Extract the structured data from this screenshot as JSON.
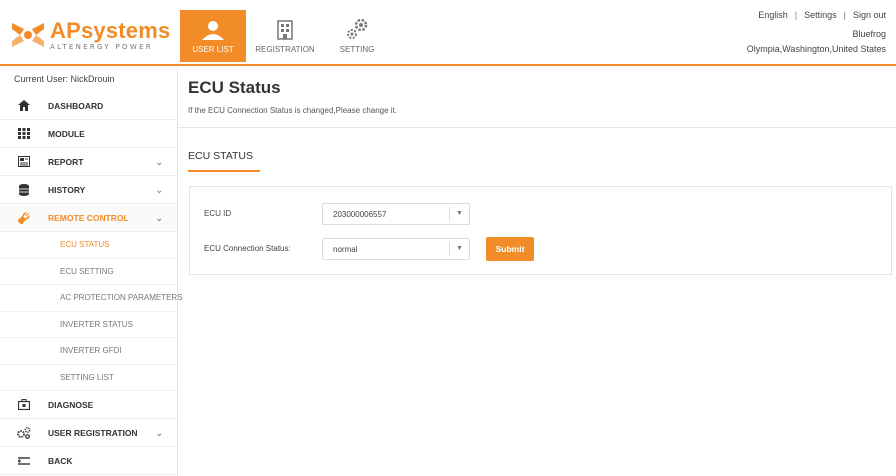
{
  "brand": {
    "name_ap": "AP",
    "name_rest": "systems",
    "tagline": "ALTENERGY POWER"
  },
  "topnav": [
    {
      "label": "USER LIST",
      "icon": "user-list-icon",
      "active": true
    },
    {
      "label": "REGISTRATION",
      "icon": "building-icon",
      "active": false
    },
    {
      "label": "SETTING",
      "icon": "gears-icon",
      "active": false
    }
  ],
  "topright": {
    "language": "English",
    "settings": "Settings",
    "signout": "Sign out",
    "username": "Bluefrog",
    "location": "Olympia,Washington,United States"
  },
  "sidebar": {
    "current_user": "Current User: NickDrouin",
    "items": [
      {
        "label": "DASHBOARD",
        "icon": "home-icon"
      },
      {
        "label": "MODULE",
        "icon": "grid-icon"
      },
      {
        "label": "REPORT",
        "icon": "report-icon"
      },
      {
        "label": "HISTORY",
        "icon": "database-icon"
      },
      {
        "label": "REMOTE CONTROL",
        "icon": "wrench-icon"
      }
    ],
    "subitems": [
      "ECU STATUS",
      "ECU SETTING",
      "AC PROTECTION PARAMETERS",
      "INVERTER STATUS",
      "INVERTER GFDI",
      "SETTING LIST"
    ],
    "bottom_items": [
      {
        "label": "DIAGNOSE",
        "icon": "briefcase-icon"
      },
      {
        "label": "USER REGISTRATION",
        "icon": "cogs-icon"
      },
      {
        "label": "BACK",
        "icon": "back-icon"
      }
    ]
  },
  "main": {
    "title": "ECU Status",
    "description": "If the ECU Connection Status is changed,Please change it.",
    "section_tab": "ECU STATUS",
    "ecu_id_label": "ECU ID",
    "ecu_id_value": "203000006557",
    "connection_label": "ECU Connection Status:",
    "connection_value": "normal",
    "submit_label": "Submit"
  },
  "colors": {
    "accent": "#f28c28"
  }
}
